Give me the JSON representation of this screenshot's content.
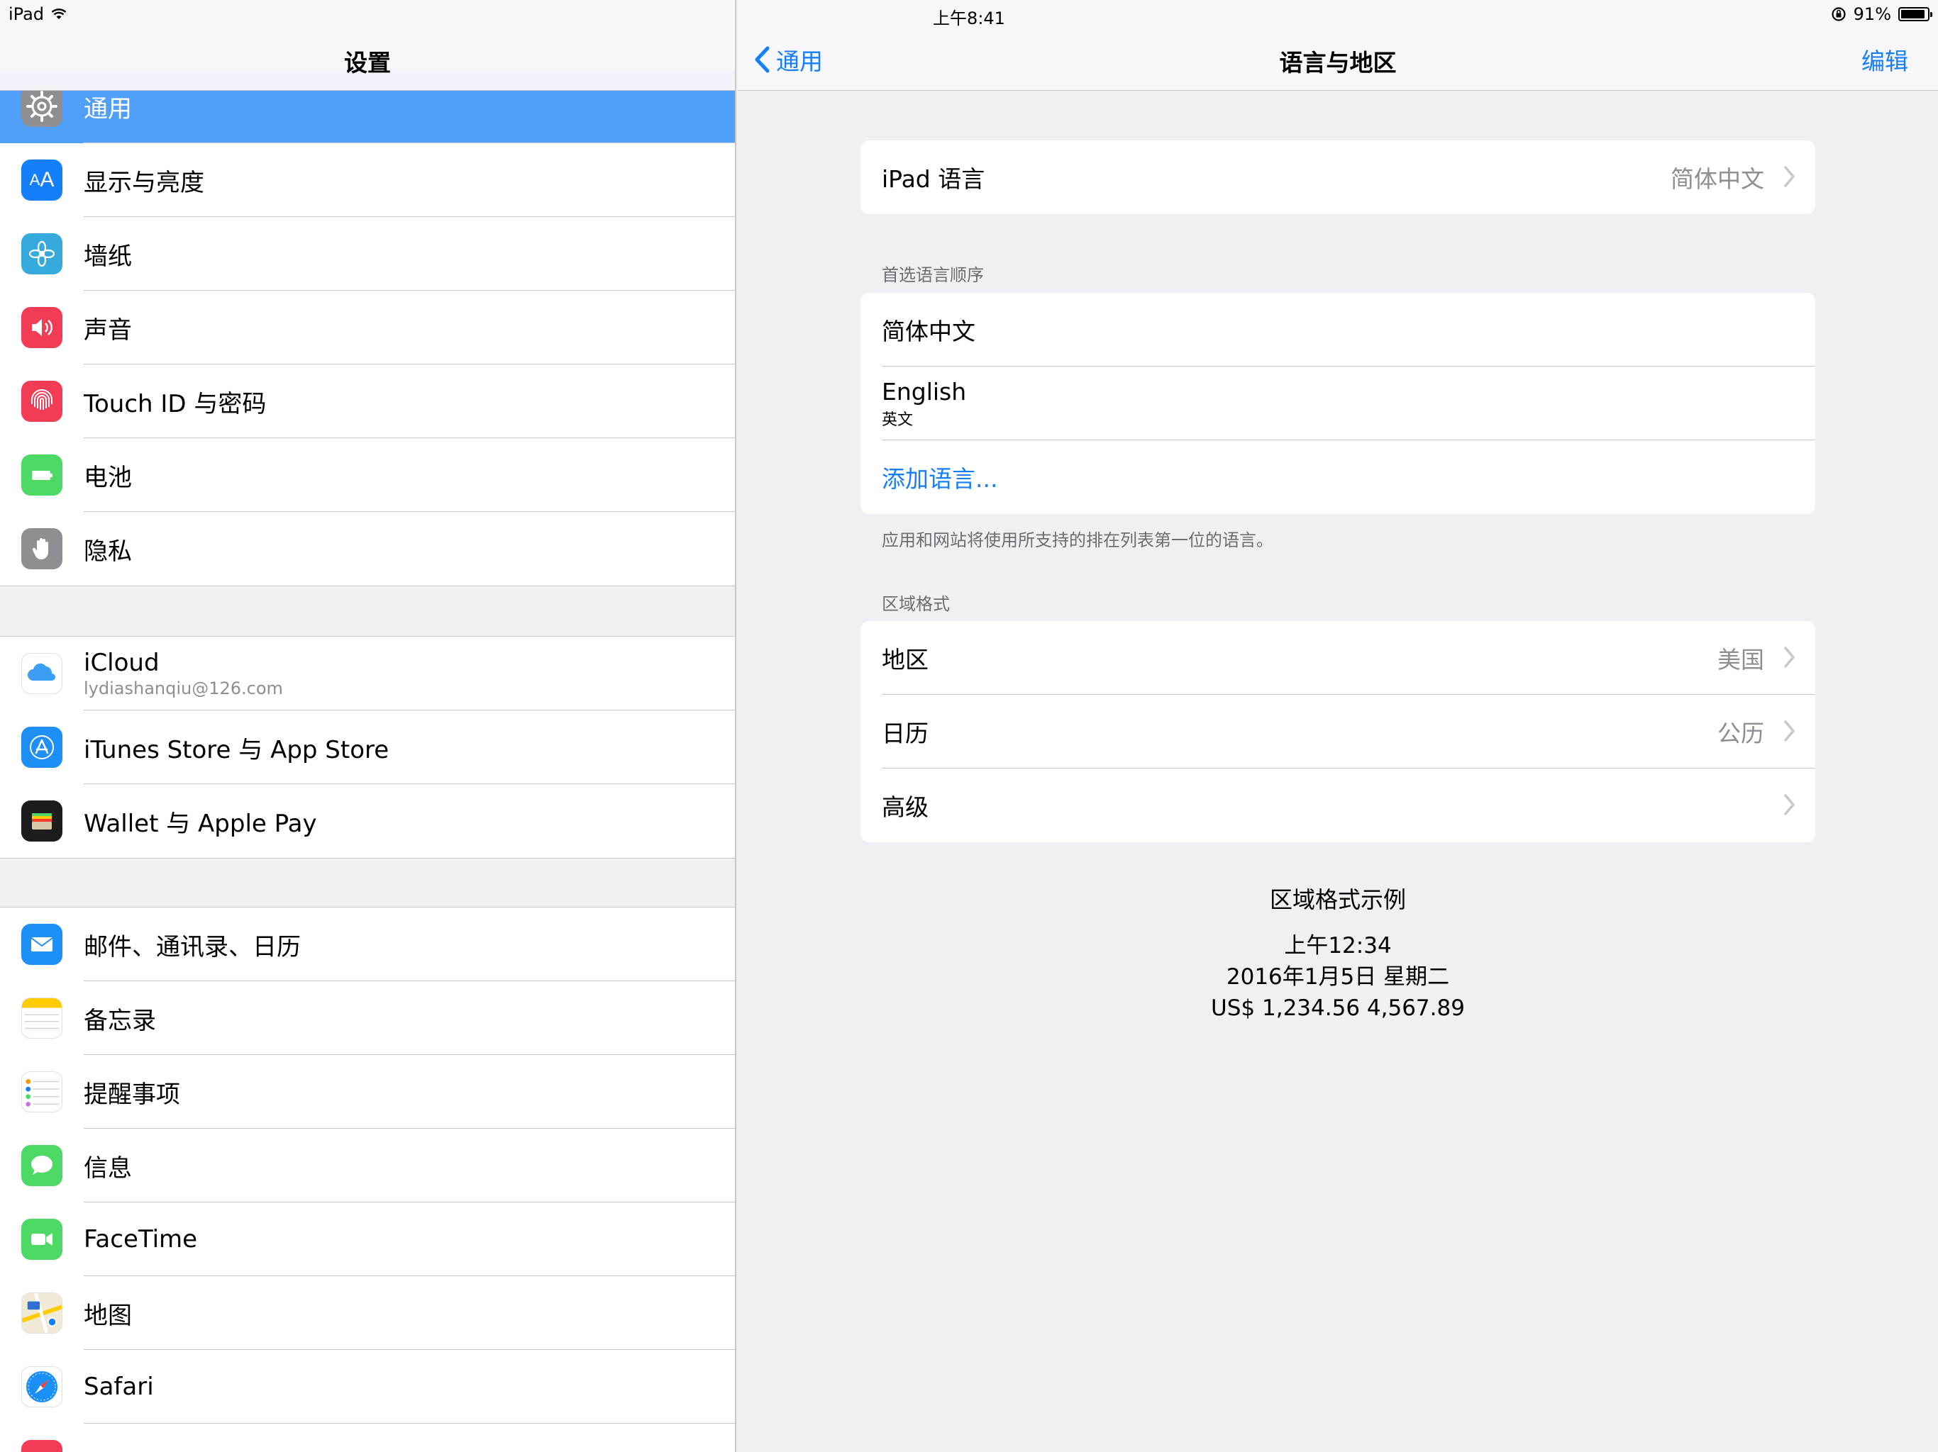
{
  "status_bar": {
    "device": "iPad",
    "time": "上午8:41",
    "battery_percent": "91%",
    "battery_level": 0.91
  },
  "master": {
    "title": "设置",
    "groups": [
      [
        {
          "label": "通用",
          "icon": "gear-icon",
          "color": "#8e8e93",
          "selected": true
        },
        {
          "label": "显示与亮度",
          "icon": "display-brightness-icon",
          "color": "#157efb"
        },
        {
          "label": "墙纸",
          "icon": "wallpaper-flower-icon",
          "color": "#36aadc"
        },
        {
          "label": "声音",
          "icon": "speaker-icon",
          "color": "#f23c55"
        },
        {
          "label": "Touch ID 与密码",
          "icon": "fingerprint-icon",
          "color": "#f23c55"
        },
        {
          "label": "电池",
          "icon": "battery-icon",
          "color": "#4cd964"
        },
        {
          "label": "隐私",
          "icon": "hand-icon",
          "color": "#8e8e93"
        }
      ],
      [
        {
          "label": "iCloud",
          "sub": "lydiashanqiu@126.com",
          "icon": "icloud-icon",
          "color": "#ffffff"
        },
        {
          "label": "iTunes Store 与 App Store",
          "icon": "app-store-icon",
          "color": "#1e8ff5"
        },
        {
          "label": "Wallet 与 Apple Pay",
          "icon": "wallet-icon",
          "color": "#1c1c1e"
        }
      ],
      [
        {
          "label": "邮件、通讯录、日历",
          "icon": "mail-icon",
          "color": "#1e8ff5"
        },
        {
          "label": "备忘录",
          "icon": "notes-icon",
          "color": "#ffffff"
        },
        {
          "label": "提醒事项",
          "icon": "reminders-icon",
          "color": "#ffffff"
        },
        {
          "label": "信息",
          "icon": "messages-icon",
          "color": "#4cd964"
        },
        {
          "label": "FaceTime",
          "icon": "facetime-icon",
          "color": "#4cd964"
        },
        {
          "label": "地图",
          "icon": "maps-icon",
          "color": "#ffffff"
        },
        {
          "label": "Safari",
          "icon": "safari-icon",
          "color": "#ffffff"
        }
      ]
    ]
  },
  "detail": {
    "back_label": "通用",
    "title": "语言与地区",
    "edit_label": "编辑",
    "ipad_language": {
      "label": "iPad 语言",
      "value": "简体中文"
    },
    "preferred_header": "首选语言顺序",
    "preferred": [
      {
        "label": "简体中文"
      },
      {
        "label": "English",
        "sub": "英文"
      }
    ],
    "add_language": "添加语言...",
    "preferred_footer": "应用和网站将使用所支持的排在列表第一位的语言。",
    "region_header": "区域格式",
    "region_rows": [
      {
        "label": "地区",
        "value": "美国"
      },
      {
        "label": "日历",
        "value": "公历"
      },
      {
        "label": "高级",
        "value": ""
      }
    ],
    "example": {
      "title": "区域格式示例",
      "time": "上午12:34",
      "date": "2016年1月5日 星期二",
      "numbers": "US$ 1,234.56   4,567.89"
    }
  },
  "colors": {
    "accent": "#157efb",
    "selected_row": "#50a0fa",
    "background": "#efeff4"
  }
}
